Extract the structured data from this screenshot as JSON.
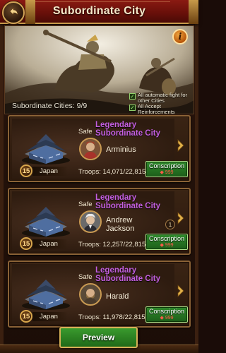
{
  "header": {
    "title": "Subordinate City",
    "back_icon": "back-arrow-icon",
    "accent": "#7a1610"
  },
  "banner": {
    "info_label": "i",
    "subordinate_count": "Subordinate Cities: 9/9",
    "options": [
      {
        "label": "All automatic fight for other Cities",
        "checked": true
      },
      {
        "label": "All Accept Reinforcements",
        "checked": true
      }
    ]
  },
  "cities": [
    {
      "status": "Safe",
      "title": "Legendary Subordinate City",
      "leader": "Arminius",
      "level": "15",
      "country": "Japan",
      "troops": "Troops: 14,071/22,815",
      "conscript_label": "Conscription",
      "conscript_cost": "◆ 999",
      "badge": ""
    },
    {
      "status": "Safe",
      "title": "Legendary Subordinate City",
      "leader": "Andrew Jackson",
      "level": "15",
      "country": "Japan",
      "troops": "Troops: 12,257/22,815",
      "conscript_label": "Conscription",
      "conscript_cost": "◆ 999",
      "badge": "1"
    },
    {
      "status": "Safe",
      "title": "Legendary Subordinate City",
      "leader": "Harald",
      "level": "15",
      "country": "Japan",
      "troops": "Troops: 11,978/22,815",
      "conscript_label": "Conscription",
      "conscript_cost": "◆ 999",
      "badge": ""
    }
  ],
  "footer": {
    "preview_label": "Preview"
  },
  "colors": {
    "legendary": "#c35fe0",
    "conscript_button": "#2a7a26",
    "gold_border": "#c99a52"
  }
}
